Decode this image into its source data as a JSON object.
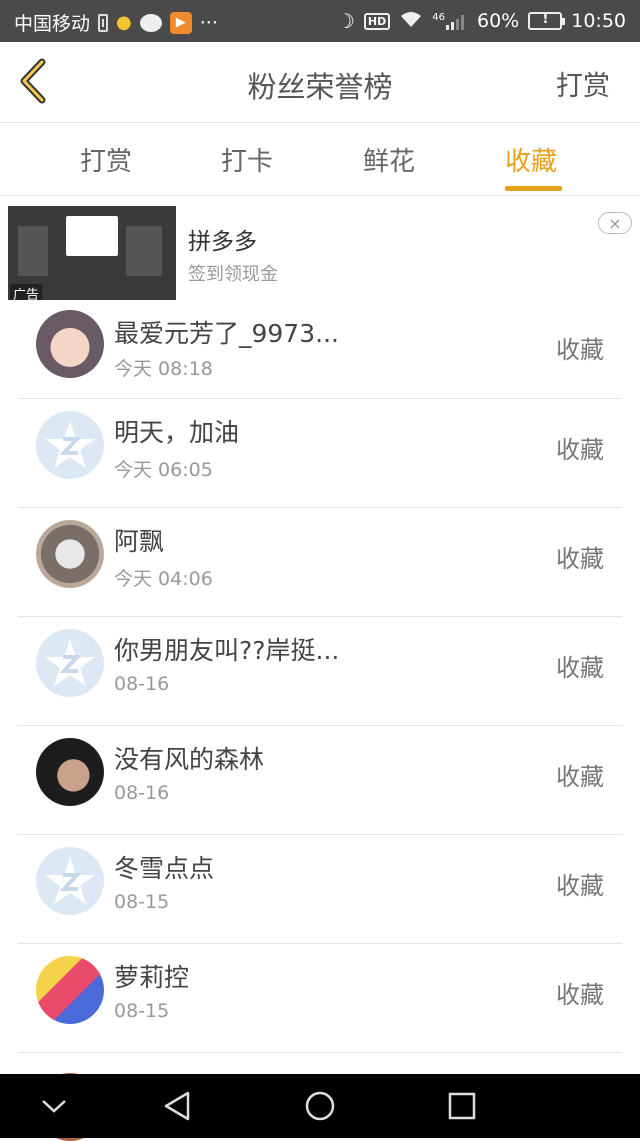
{
  "status_bar": {
    "carrier": "中国移动",
    "more_dots": "···",
    "hd": "HD",
    "signal": "46",
    "battery": "60%",
    "time": "10:50"
  },
  "header": {
    "title": "粉丝荣誉榜",
    "action_label": "打赏"
  },
  "tabs": [
    {
      "label": "打赏"
    },
    {
      "label": "打卡"
    },
    {
      "label": "鲜花"
    },
    {
      "label": "收藏"
    }
  ],
  "active_tab": "收藏",
  "ad": {
    "tag": "广告",
    "title": "拼多多",
    "subtitle": "签到领现金",
    "close": "×"
  },
  "fans": [
    {
      "name": "最爱元芳了_9973...",
      "time": "今天 08:18",
      "action": "收藏",
      "avatar": "anime-girl"
    },
    {
      "name": "明天，加油",
      "time": "今天 06:05",
      "action": "收藏",
      "avatar": "default"
    },
    {
      "name": "阿飘",
      "time": "今天 04:06",
      "action": "收藏",
      "avatar": "husky"
    },
    {
      "name": "你男朋友叫??岸挺...",
      "time": "08-16",
      "action": "收藏",
      "avatar": "default"
    },
    {
      "name": "没有风的森林",
      "time": "08-16",
      "action": "收藏",
      "avatar": "boy"
    },
    {
      "name": "冬雪点点",
      "time": "08-15",
      "action": "收藏",
      "avatar": "default"
    },
    {
      "name": "萝莉控",
      "time": "08-15",
      "action": "收藏",
      "avatar": "anime-group"
    }
  ],
  "colors": {
    "accent": "#e9a019",
    "status_bar": "#4a4a4a",
    "nav_bar": "#000000"
  }
}
